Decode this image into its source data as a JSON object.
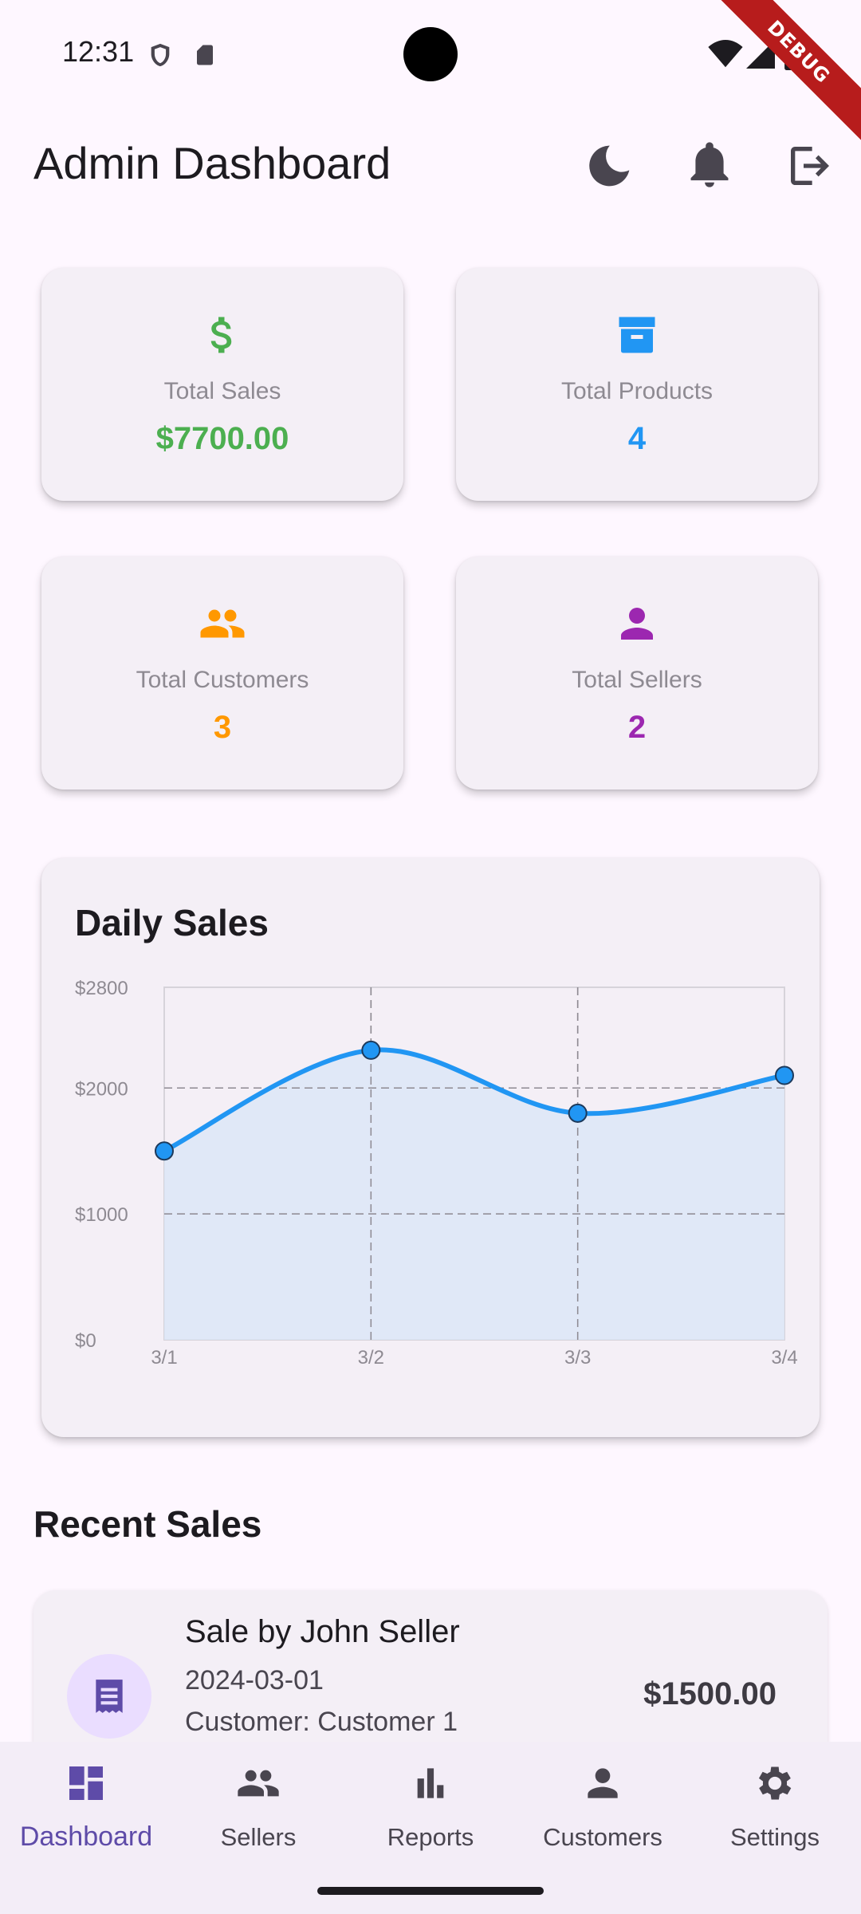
{
  "status_bar": {
    "time": "12:31",
    "debug_label": "DEBUG"
  },
  "app_bar": {
    "title": "Admin Dashboard"
  },
  "stats": [
    {
      "label": "Total Sales",
      "value": "$7700.00",
      "color": "#4CAF50",
      "icon": "dollar-icon"
    },
    {
      "label": "Total Products",
      "value": "4",
      "color": "#2196F3",
      "icon": "archive-box-icon"
    },
    {
      "label": "Total Customers",
      "value": "3",
      "color": "#FF9800",
      "icon": "group-icon"
    },
    {
      "label": "Total Sellers",
      "value": "2",
      "color": "#9C27B0",
      "icon": "person-icon"
    }
  ],
  "chart": {
    "title": "Daily Sales"
  },
  "chart_data": {
    "type": "area",
    "title": "Daily Sales",
    "x": [
      "3/1",
      "3/2",
      "3/3",
      "3/4"
    ],
    "series": [
      {
        "values": [
          1500,
          2300,
          1800,
          2100
        ],
        "color": "#2196F3"
      }
    ],
    "y_ticks": [
      "$0",
      "$1000",
      "$2000",
      "$2800"
    ],
    "ylim": [
      0,
      2800
    ],
    "grid": true
  },
  "recent_sales": {
    "title": "Recent Sales",
    "items": [
      {
        "title": "Sale by John Seller",
        "date": "2024-03-01",
        "customer": "Customer: Customer 1",
        "amount": "$1500.00"
      }
    ]
  },
  "bottom_nav": {
    "items": [
      {
        "label": "Dashboard",
        "icon": "dashboard-icon",
        "active": true
      },
      {
        "label": "Sellers",
        "icon": "people-icon",
        "active": false
      },
      {
        "label": "Reports",
        "icon": "bar-chart-icon",
        "active": false
      },
      {
        "label": "Customers",
        "icon": "person-icon",
        "active": false
      },
      {
        "label": "Settings",
        "icon": "gear-icon",
        "active": false
      }
    ]
  }
}
